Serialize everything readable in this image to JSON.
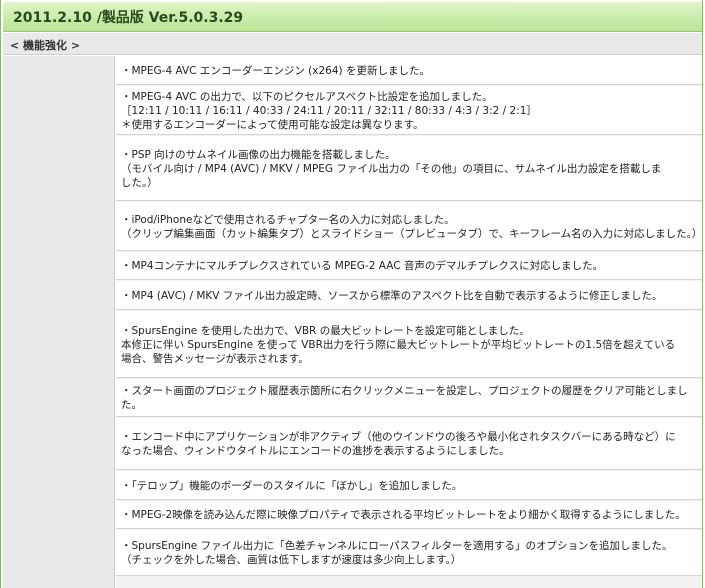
{
  "header": {
    "title": "2011.2.10 /製品版 Ver.5.0.3.29"
  },
  "category": {
    "label": "< 機能強化 >"
  },
  "items": [
    {
      "lines": [
        "・MPEG-4 AVC エンコーダーエンジン (x264) を更新しました。"
      ]
    },
    {
      "lines": [
        "・MPEG-4 AVC の出力で、以下のピクセルアスペクト比設定を追加しました。",
        "［12:11 / 10:11 / 16:11 / 40:33 / 24:11 / 20:11 / 32:11 / 80:33 / 4:3 / 3:2 / 2:1］",
        "＊使用するエンコーダーによって使用可能な設定は異なります。"
      ]
    },
    {
      "lines": [
        "・PSP 向けのサムネイル画像の出力機能を搭載しました。",
        "（モバイル向け / MP4 (AVC) / MKV / MPEG ファイル出力の「その他」の項目に、サムネイル出力設定を搭載しま",
        "した。）"
      ]
    },
    {
      "lines": [
        "・iPod/iPhoneなどで使用されるチャプター名の入力に対応しました。",
        "（クリップ編集画面（カット編集タブ）とスライドショー（プレビュータブ）で、キーフレーム名の入力に対応しました。）"
      ]
    },
    {
      "lines": [
        "・MP4コンテナにマルチプレクスされている MPEG-2 AAC 音声のデマルチプレクスに対応しました。"
      ]
    },
    {
      "lines": [
        "・MP4 (AVC) / MKV ファイル出力設定時、ソースから標準のアスペクト比を自動で表示するように修正しました。"
      ]
    },
    {
      "lines": [
        "・SpursEngine を使用した出力で、VBR の最大ビットレートを設定可能としました。",
        "本修正に伴い SpursEngine を使って VBR出力を行う際に最大ビットレートが平均ビットレートの1.5倍を超えている",
        "場合、警告メッセージが表示されます。"
      ]
    },
    {
      "lines": [
        "・スタート画面のプロジェクト履歴表示箇所に右クリックメニューを設定し、プロジェクトの履歴をクリア可能としまし",
        "た。"
      ]
    },
    {
      "lines": [
        "・エンコード中にアプリケーションが非アクティブ（他のウインドウの後ろや最小化されタスクバーにある時など）に",
        "なった場合、ウィンドウタイトルにエンコードの進捗を表示するようにしました。"
      ]
    },
    {
      "lines": [
        "・「テロップ」機能のボーダーのスタイルに「ぼかし」を追加しました。"
      ]
    },
    {
      "lines": [
        "・MPEG-2映像を読み込んだ際に映像プロパティで表示される平均ビットレートをより細かく取得するようにしました。"
      ]
    },
    {
      "lines": [
        "・SpursEngine ファイル出力に「色差チャンネルにローパスフィルターを適用する」のオプションを追加しました。",
        "（チェックを外した場合、画質は低下しますが速度は多少向上します。）"
      ]
    }
  ]
}
